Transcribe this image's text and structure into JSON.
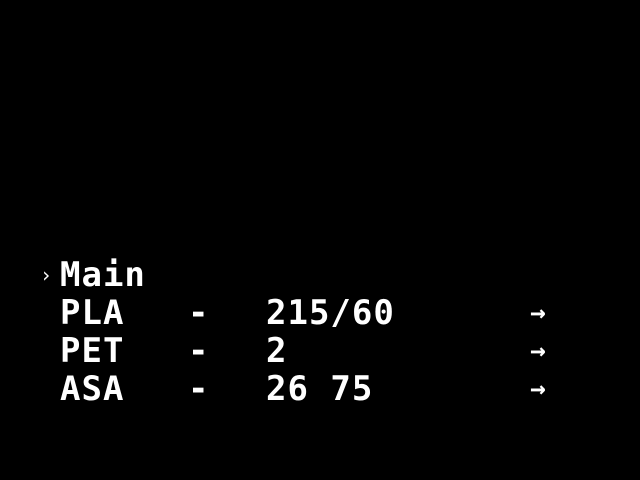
{
  "menu": {
    "cursor_glyph": "›",
    "title": "Main",
    "items": [
      {
        "material": "PLA",
        "separator": "-",
        "temps": "215/60",
        "arrow": "→"
      },
      {
        "material": "PET",
        "separator": "-",
        "temps": "2",
        "arrow": "→"
      },
      {
        "material": "ASA",
        "separator": "-",
        "temps": "26 75",
        "arrow": "→"
      }
    ]
  },
  "colors": {
    "background": "#000000",
    "foreground": "#ffffff"
  }
}
